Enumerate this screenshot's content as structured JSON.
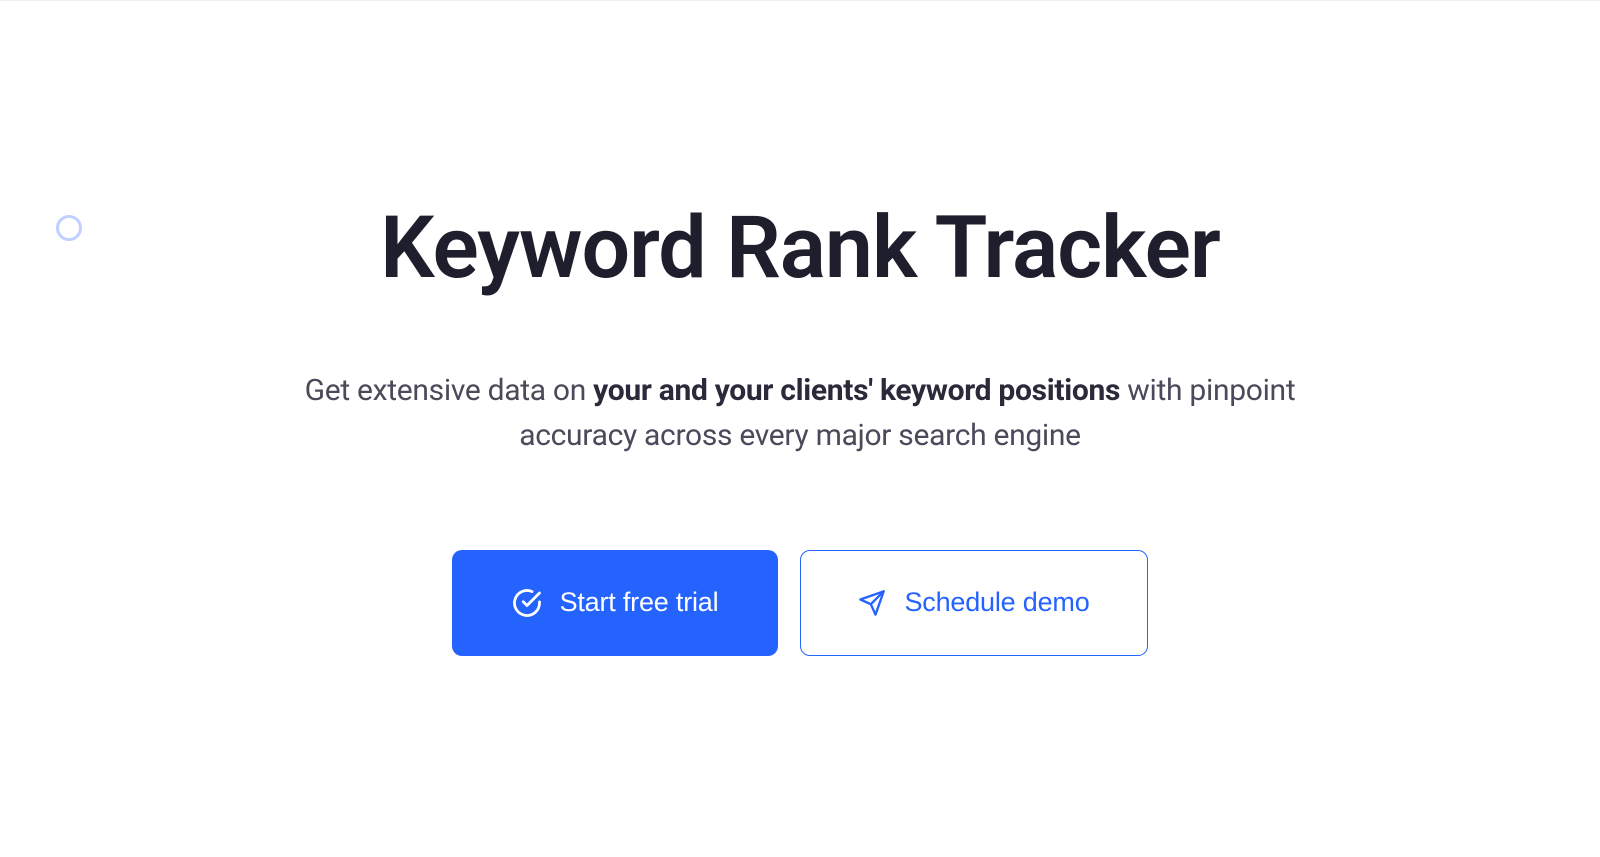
{
  "hero": {
    "title": "Keyword Rank Tracker",
    "subtitle_prefix": "Get extensive data on ",
    "subtitle_bold": "your and your clients' keyword positions",
    "subtitle_suffix": " with pinpoint accuracy across every major search engine"
  },
  "buttons": {
    "primary_label": "Start free trial",
    "secondary_label": "Schedule demo"
  }
}
